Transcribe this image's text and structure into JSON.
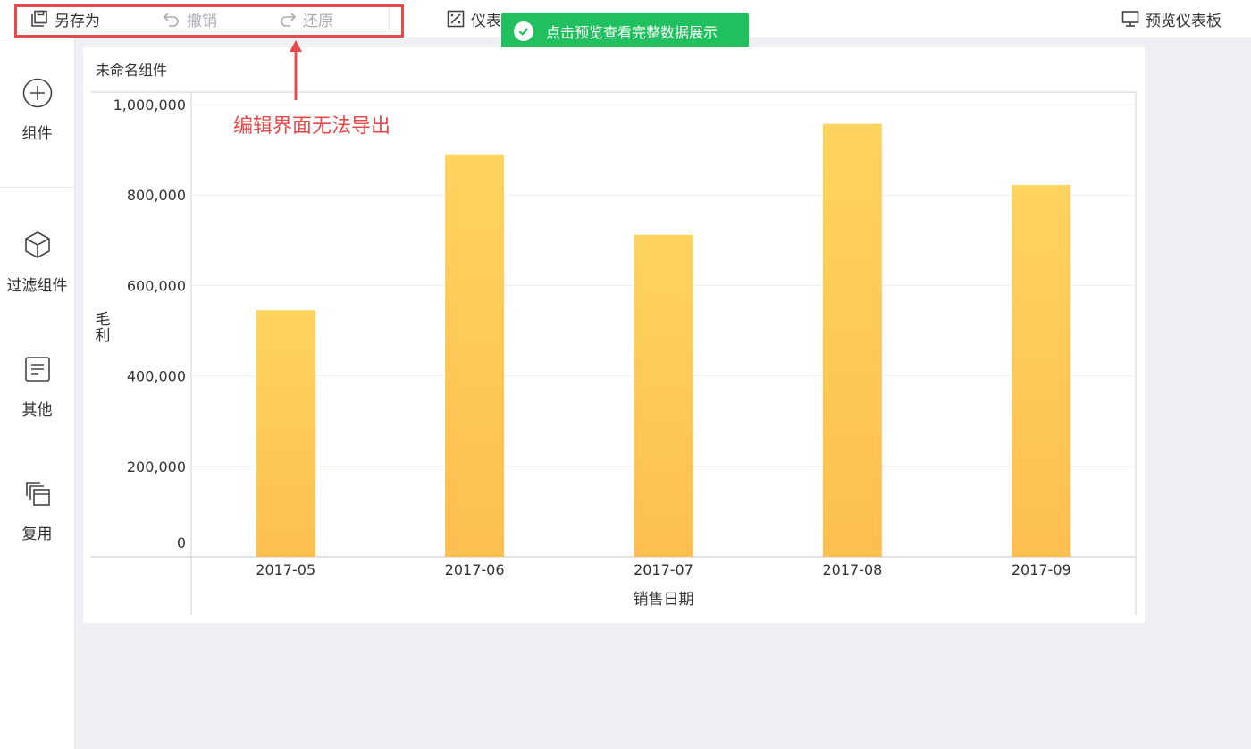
{
  "toolbar": {
    "save_as_label": "另存为",
    "undo_label": "撤销",
    "redo_label": "还原",
    "dashboard_style_label": "仪表",
    "preview_label": "预览仪表板"
  },
  "toast": {
    "message": "点击预览查看完整数据展示"
  },
  "annotation": {
    "text": "编辑界面无法导出",
    "color": "#e84a4a"
  },
  "sidebar": {
    "items": [
      {
        "label": "组件",
        "icon": "plus-circle-icon"
      },
      {
        "label": "过滤组件",
        "icon": "cube-icon"
      },
      {
        "label": "其他",
        "icon": "document-icon"
      },
      {
        "label": "复用",
        "icon": "copy-icon"
      }
    ]
  },
  "component": {
    "title": "未命名组件"
  },
  "chart_data": {
    "type": "bar",
    "categories": [
      "2017-05",
      "2017-06",
      "2017-07",
      "2017-08",
      "2017-09"
    ],
    "values": [
      545000,
      890000,
      712000,
      957000,
      822000
    ],
    "xlabel": "销售日期",
    "ylabel": "毛利",
    "y_ticks": [
      "0",
      "200,000",
      "400,000",
      "600,000",
      "800,000",
      "1,000,000"
    ],
    "ylim": [
      0,
      1000000
    ],
    "grid": true,
    "bar_color_top": "#fed35e",
    "bar_color_bottom": "#fdbf50"
  }
}
